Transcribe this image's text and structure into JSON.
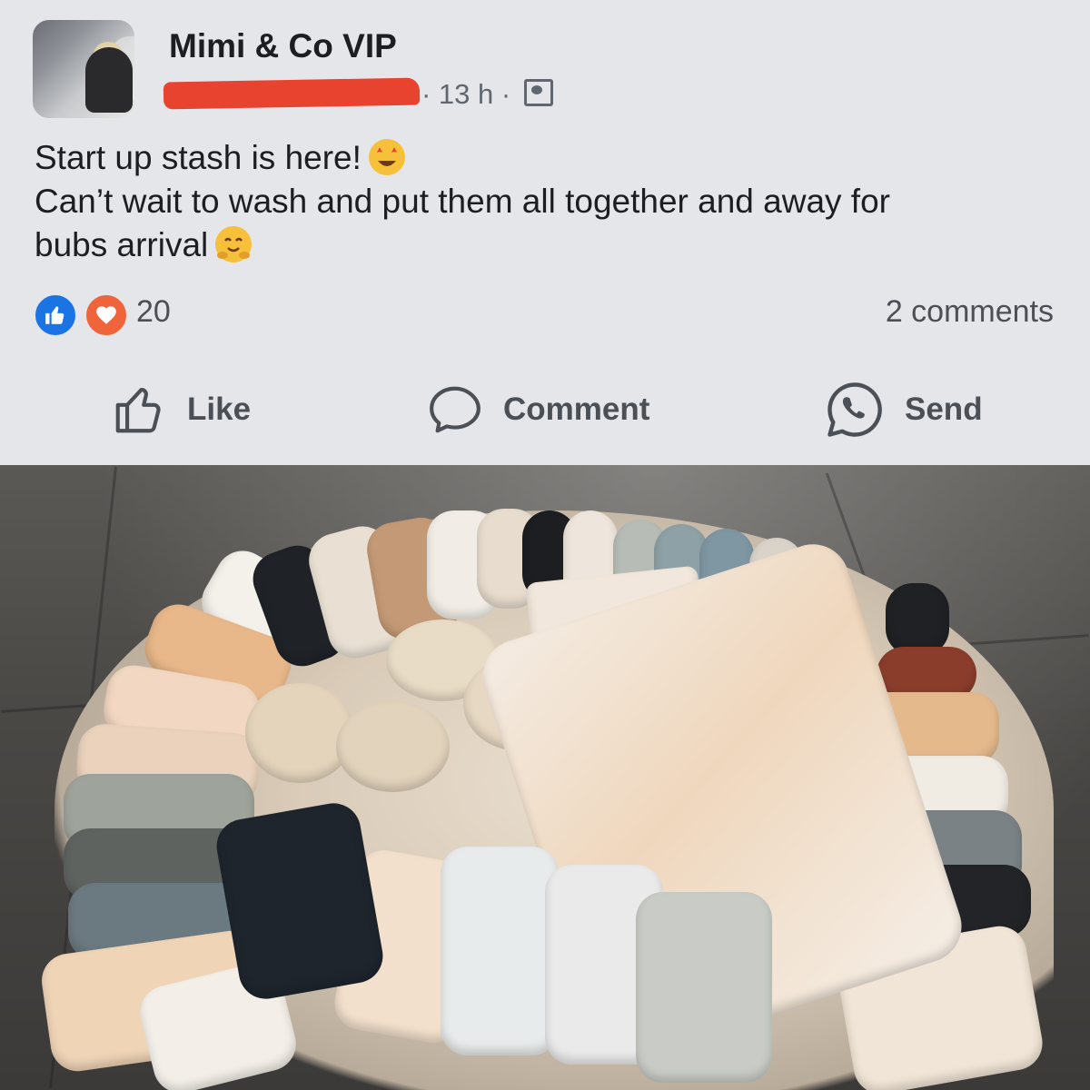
{
  "post": {
    "group_name": "Mimi & Co VIP",
    "time": "· 13 h ·",
    "text_line_1": "Start up stash is here!",
    "text_line_2": "Can’t wait to wash and put them all together and away for",
    "text_line_3": "bubs arrival",
    "reaction_count": "20",
    "comments_label": "2 comments"
  },
  "actions": {
    "like_label": "Like",
    "comment_label": "Comment",
    "send_label": "Send"
  },
  "icons": {
    "emoji_1": "star-struck-emoji-icon",
    "emoji_2": "hugging-face-emoji-icon",
    "reaction_like": "like-reaction-icon",
    "reaction_love": "love-reaction-icon",
    "audience": "group-audience-icon"
  },
  "colors": {
    "like_blue": "#1b74e4",
    "love_orange": "#f0643c",
    "redaction_red": "#e8432e"
  }
}
